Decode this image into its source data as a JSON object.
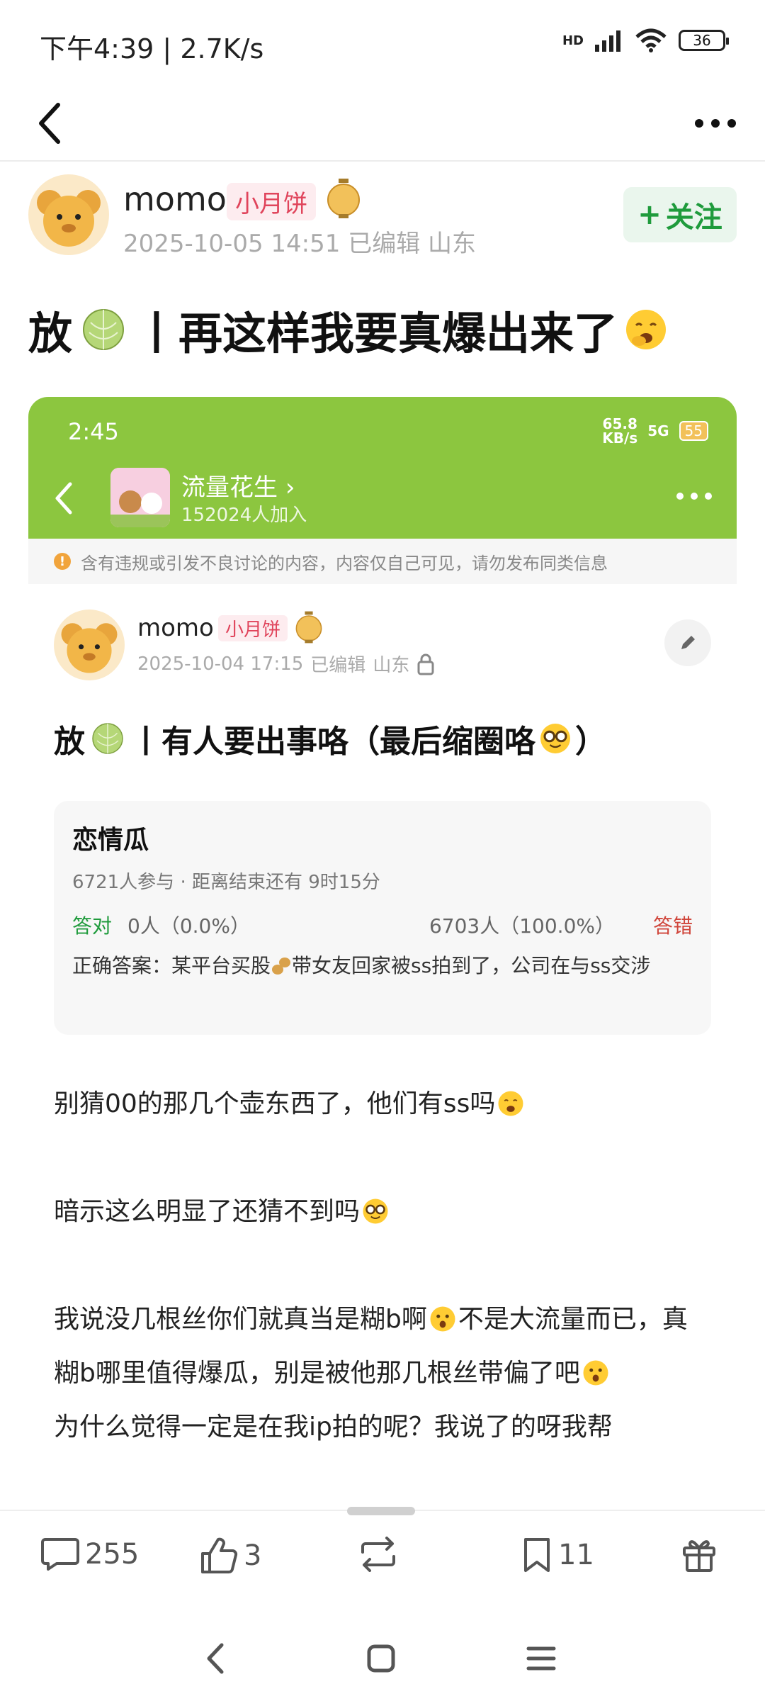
{
  "status_bar": {
    "time": "下午4:39",
    "speed": "2.7K/s",
    "network": "HD",
    "battery": "36"
  },
  "author": {
    "name": "momo",
    "badge": "小月饼",
    "date": "2025-10-05 14:51",
    "edited": "已编辑",
    "location": "山东",
    "follow_label": "关注"
  },
  "post": {
    "title_prefix": "放",
    "title_text": "丨再这样我要真爆出来了"
  },
  "embed": {
    "status_time": "2:45",
    "net_speed": "65.8",
    "net_unit": "KB/s",
    "net_type": "5G",
    "battery": "55",
    "group_name": "流量花生",
    "group_count": "152024人加入",
    "warning": "含有违规或引发不良讨论的内容，内容仅自己可见，请勿发布同类信息",
    "author_name": "momo",
    "author_badge": "小月饼",
    "author_date": "2025-10-04 17:15",
    "author_edited": "已编辑",
    "author_location": "山东",
    "title_prefix": "放",
    "title_text": "丨有人要出事咯（最后缩圈咯",
    "title_suffix": "）",
    "quiz": {
      "title": "恋情瓜",
      "participants": "6721人参与",
      "sep": "·",
      "remaining": "距离结束还有 9时15分",
      "right_label": "答对",
      "right_value": "0人（0.0%）",
      "wrong_value": "6703人（100.0%）",
      "wrong_label": "答错",
      "answer_prefix": "正确答案：某平台买股",
      "answer_suffix": "带女友回家被ss拍到了，公司在与ss交涉"
    },
    "body": {
      "p1": "别猜00的那几个壶东西了，他们有ss吗",
      "p2": "暗示这么明显了还猜不到吗",
      "p3a": "我说没几根丝你们就真当是糊b啊",
      "p3b": "不是大流量而已，真糊b哪里值得爆瓜，别是被他那几根丝带偏了吧",
      "p4": "为什么觉得一定是在我ip拍的呢？我说了的呀我帮"
    }
  },
  "actions": {
    "comments": "255",
    "likes": "3",
    "favorites": "11"
  },
  "colors": {
    "accent_green": "#1f9b3c",
    "embed_header": "#8cc63f",
    "badge_red": "#e0445b",
    "wrong_red": "#d0453a"
  }
}
